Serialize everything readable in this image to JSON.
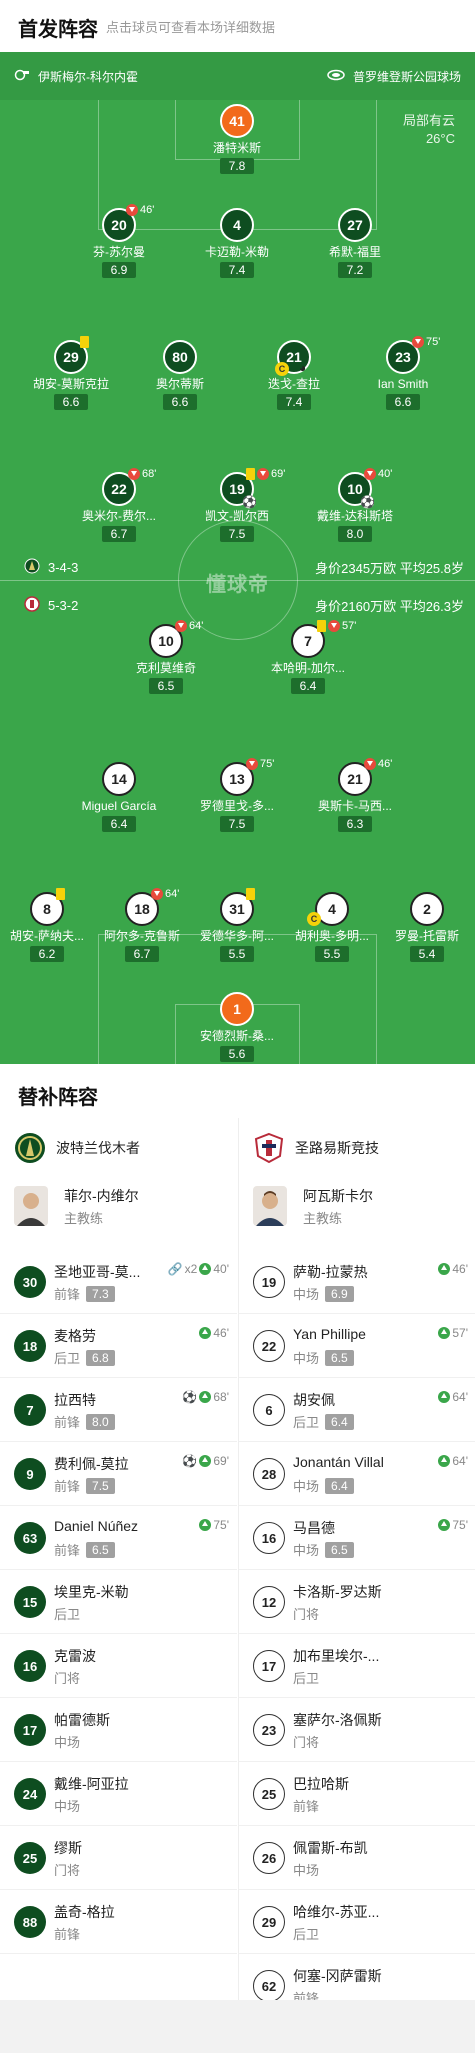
{
  "header": {
    "title": "首发阵容",
    "hint": "点击球员可查看本场详细数据"
  },
  "pitch": {
    "home_team": "伊斯梅尔-科尔内霍",
    "venue": "普罗维登斯公园球场",
    "weather": "局部有云",
    "temperature": "26°C",
    "watermark": "懂球帝",
    "home_formation": "3-4-3",
    "home_value": "身价2345万欧 平均25.8岁",
    "away_formation": "5-3-2",
    "away_value": "身价2160万欧 平均26.3岁",
    "colors": {
      "grass": "#3aa64a",
      "home": "#0e4d20",
      "gk": "#f26a1b",
      "rating": "#1d6e2c"
    }
  },
  "starters": [
    {
      "id": "h41",
      "num": "41",
      "name": "潘特米斯",
      "rating": "7.8"
    },
    {
      "id": "h20",
      "num": "20",
      "name": "芬-苏尔曼",
      "rating": "6.9",
      "sub": "46'"
    },
    {
      "id": "h4",
      "num": "4",
      "name": "卡迈勒-米勒",
      "rating": "7.4"
    },
    {
      "id": "h27",
      "num": "27",
      "name": "希默-福里",
      "rating": "7.2"
    },
    {
      "id": "h29",
      "num": "29",
      "name": "胡安-莫斯克拉",
      "rating": "6.6"
    },
    {
      "id": "h80",
      "num": "80",
      "name": "奥尔蒂斯",
      "rating": "6.6"
    },
    {
      "id": "h21",
      "num": "21",
      "name": "迭戈-查拉",
      "rating": "7.4"
    },
    {
      "id": "h23",
      "num": "23",
      "name": "Ian Smith",
      "rating": "6.6",
      "sub": "75'"
    },
    {
      "id": "h22",
      "num": "22",
      "name": "奥米尔-费尔...",
      "rating": "6.7",
      "sub": "68'"
    },
    {
      "id": "h19",
      "num": "19",
      "name": "凯文-凯尔西",
      "rating": "7.5",
      "sub": "69'"
    },
    {
      "id": "h10",
      "num": "10",
      "name": "戴维-达科斯塔",
      "rating": "8.0",
      "sub": "40'"
    },
    {
      "id": "a10",
      "num": "10",
      "name": "克利莫维奇",
      "rating": "6.5",
      "sub": "64'"
    },
    {
      "id": "a7",
      "num": "7",
      "name": "本哈明-加尔...",
      "rating": "6.4",
      "sub": "57'"
    },
    {
      "id": "a14",
      "num": "14",
      "name": "Miguel García",
      "rating": "6.4"
    },
    {
      "id": "a13",
      "num": "13",
      "name": "罗德里戈-多...",
      "rating": "7.5",
      "sub": "75'"
    },
    {
      "id": "a21",
      "num": "21",
      "name": "奥斯卡-马西...",
      "rating": "6.3",
      "sub": "46'"
    },
    {
      "id": "a8",
      "num": "8",
      "name": "胡安-萨纳夫...",
      "rating": "6.2"
    },
    {
      "id": "a18",
      "num": "18",
      "name": "阿尔多-克鲁斯",
      "rating": "6.7",
      "sub": "64'"
    },
    {
      "id": "a31",
      "num": "31",
      "name": "爱德华多-阿...",
      "rating": "5.5"
    },
    {
      "id": "a4",
      "num": "4",
      "name": "胡利奥-多明...",
      "rating": "5.5"
    },
    {
      "id": "a2",
      "num": "2",
      "name": "罗曼-托雷斯",
      "rating": "5.4"
    },
    {
      "id": "a1",
      "num": "1",
      "name": "安德烈斯-桑...",
      "rating": "5.6"
    }
  ],
  "subs": {
    "title": "替补阵容",
    "home": {
      "team": "波特兰伐木者",
      "coach_name": "菲尔-内维尔",
      "coach_role": "主教练",
      "players": [
        {
          "num": "30",
          "name": "圣地亚哥-莫...",
          "pos": "前锋",
          "rating": "7.3",
          "event": "x2",
          "min": "40'"
        },
        {
          "num": "18",
          "name": "麦格劳",
          "pos": "后卫",
          "rating": "6.8",
          "min": "46'"
        },
        {
          "num": "7",
          "name": "拉西特",
          "pos": "前锋",
          "rating": "8.0",
          "min": "68'"
        },
        {
          "num": "9",
          "name": "费利佩-莫拉",
          "pos": "前锋",
          "rating": "7.5",
          "min": "69'"
        },
        {
          "num": "63",
          "name": "Daniel Núñez",
          "pos": "前锋",
          "rating": "6.5",
          "min": "75'"
        },
        {
          "num": "15",
          "name": "埃里克-米勒",
          "pos": "后卫"
        },
        {
          "num": "16",
          "name": "克雷波",
          "pos": "门将"
        },
        {
          "num": "17",
          "name": "帕雷德斯",
          "pos": "中场"
        },
        {
          "num": "24",
          "name": "戴维-阿亚拉",
          "pos": "中场"
        },
        {
          "num": "25",
          "name": "缪斯",
          "pos": "门将"
        },
        {
          "num": "88",
          "name": "盖奇-格拉",
          "pos": "前锋"
        }
      ]
    },
    "away": {
      "team": "圣路易斯竞技",
      "coach_name": "阿瓦斯卡尔",
      "coach_role": "主教练",
      "players": [
        {
          "num": "19",
          "name": "萨勒-拉蒙热",
          "pos": "中场",
          "rating": "6.9",
          "min": "46'"
        },
        {
          "num": "22",
          "name": "Yan Phillipe",
          "pos": "中场",
          "rating": "6.5",
          "min": "57'"
        },
        {
          "num": "6",
          "name": "胡安佩",
          "pos": "后卫",
          "rating": "6.4",
          "min": "64'"
        },
        {
          "num": "28",
          "name": "Jonantán Villal",
          "pos": "中场",
          "rating": "6.4",
          "min": "64'"
        },
        {
          "num": "16",
          "name": "马昌德",
          "pos": "中场",
          "rating": "6.5",
          "min": "75'"
        },
        {
          "num": "12",
          "name": "卡洛斯-罗达斯",
          "pos": "门将"
        },
        {
          "num": "17",
          "name": "加布里埃尔-...",
          "pos": "后卫"
        },
        {
          "num": "23",
          "name": "塞萨尔-洛佩斯",
          "pos": "门将"
        },
        {
          "num": "25",
          "name": "巴拉哈斯",
          "pos": "前锋"
        },
        {
          "num": "26",
          "name": "佩雷斯-布凯",
          "pos": "中场"
        },
        {
          "num": "29",
          "name": "哈维尔-苏亚...",
          "pos": "后卫"
        },
        {
          "num": "62",
          "name": "何塞-冈萨雷斯",
          "pos": "前锋"
        }
      ]
    }
  }
}
